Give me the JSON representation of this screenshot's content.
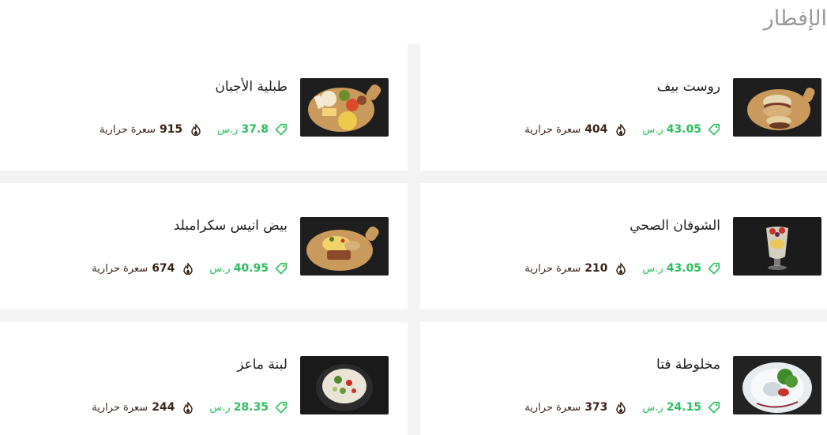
{
  "section": {
    "title": "الإفطار"
  },
  "colors": {
    "price": "#2bbf5b",
    "calories": "#3a2418",
    "title": "#9a9a9a"
  },
  "items": [
    {
      "name": "روست بيف",
      "price": "43.05",
      "currency": "ر.س",
      "calories": "404",
      "calories_unit": "سعرة حرارية",
      "image_icon": "roast-beef-sandwich-image"
    },
    {
      "name": "طبلية الأجبان",
      "price": "37.8",
      "currency": "ر.س",
      "calories": "915",
      "calories_unit": "سعرة حرارية",
      "image_icon": "cheese-board-image"
    },
    {
      "name": "الشوفان الصحي",
      "price": "43.05",
      "currency": "ر.س",
      "calories": "210",
      "calories_unit": "سعرة حرارية",
      "image_icon": "oatmeal-glass-image"
    },
    {
      "name": "بيض انيس سكرامبلد",
      "price": "40.95",
      "currency": "ر.س",
      "calories": "674",
      "calories_unit": "سعرة حرارية",
      "image_icon": "scrambled-eggs-board-image"
    },
    {
      "name": "مخلوطة فتا",
      "price": "24.15",
      "currency": "ر.س",
      "calories": "373",
      "calories_unit": "سعرة حرارية",
      "image_icon": "feta-salad-plate-image"
    },
    {
      "name": "لبنة ماعز",
      "price": "28.35",
      "currency": "ر.س",
      "calories": "244",
      "calories_unit": "سعرة حرارية",
      "image_icon": "labneh-bowl-image"
    }
  ]
}
